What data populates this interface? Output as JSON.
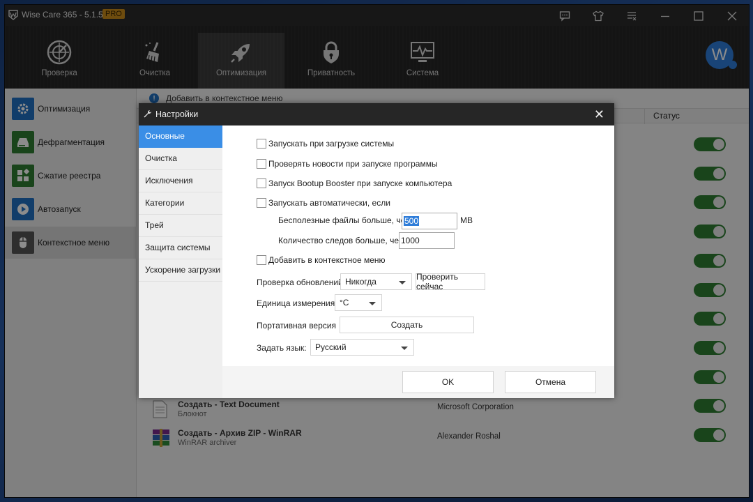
{
  "window": {
    "title": "Wise Care 365 - 5.1.5",
    "badge": "PRO"
  },
  "nav": {
    "items": [
      {
        "label": "Проверка",
        "icon": "radar-icon"
      },
      {
        "label": "Очистка",
        "icon": "broom-icon"
      },
      {
        "label": "Оптимизация",
        "icon": "rocket-icon"
      },
      {
        "label": "Приватность",
        "icon": "lock-icon"
      },
      {
        "label": "Система",
        "icon": "monitor-pulse-icon"
      }
    ],
    "active_index": 2,
    "avatar_letter": "W"
  },
  "sidebar": {
    "items": [
      {
        "label": "Оптимизация",
        "color": "#1f6fc1"
      },
      {
        "label": "Дефрагментация",
        "color": "#2e7d32"
      },
      {
        "label": "Сжатие реестра",
        "color": "#2e7d32"
      },
      {
        "label": "Автозапуск",
        "color": "#1f6fc1"
      },
      {
        "label": "Контекстное меню",
        "color": "#555555"
      }
    ],
    "active_index": 4
  },
  "content": {
    "header": "Добавить в контекстное меню",
    "status_column": "Статус",
    "toggle_count": 11,
    "rows": [
      {
        "title": "Создать - Text Document",
        "subtitle": "Блокнот",
        "publisher": "Microsoft Corporation"
      },
      {
        "title": "Создать - Архив ZIP - WinRAR",
        "subtitle": "WinRAR archiver",
        "publisher": "Alexander Roshal"
      }
    ]
  },
  "dialog": {
    "title": "Настройки",
    "nav": [
      "Основные",
      "Очистка",
      "Исключения",
      "Категории",
      "Трей",
      "Защита системы",
      "Ускорение загрузки"
    ],
    "nav_active": 0,
    "checkboxes": {
      "startup": "Запускать при загрузке системы",
      "news": "Проверять новости при запуске программы",
      "bootup": "Запуск Bootup Booster при запуске компьютера",
      "auto": "Запускать автоматически, если",
      "context": "Добавить в контекстное меню"
    },
    "junk_label": "Бесполезные файлы больше, чем",
    "junk_value": "500",
    "junk_unit": "MB",
    "traces_label": "Количество следов больше, чем",
    "traces_value": "1000",
    "updates_label": "Проверка обновлений",
    "updates_value": "Никогда",
    "check_now": "Проверить сейчас",
    "unit_label": "Единица измерения:",
    "unit_value": "°C",
    "portable_label": "Портативная версия",
    "create_button": "Создать",
    "language_label": "Задать язык:",
    "language_value": "Русский",
    "ok": "OK",
    "cancel": "Отмена"
  }
}
